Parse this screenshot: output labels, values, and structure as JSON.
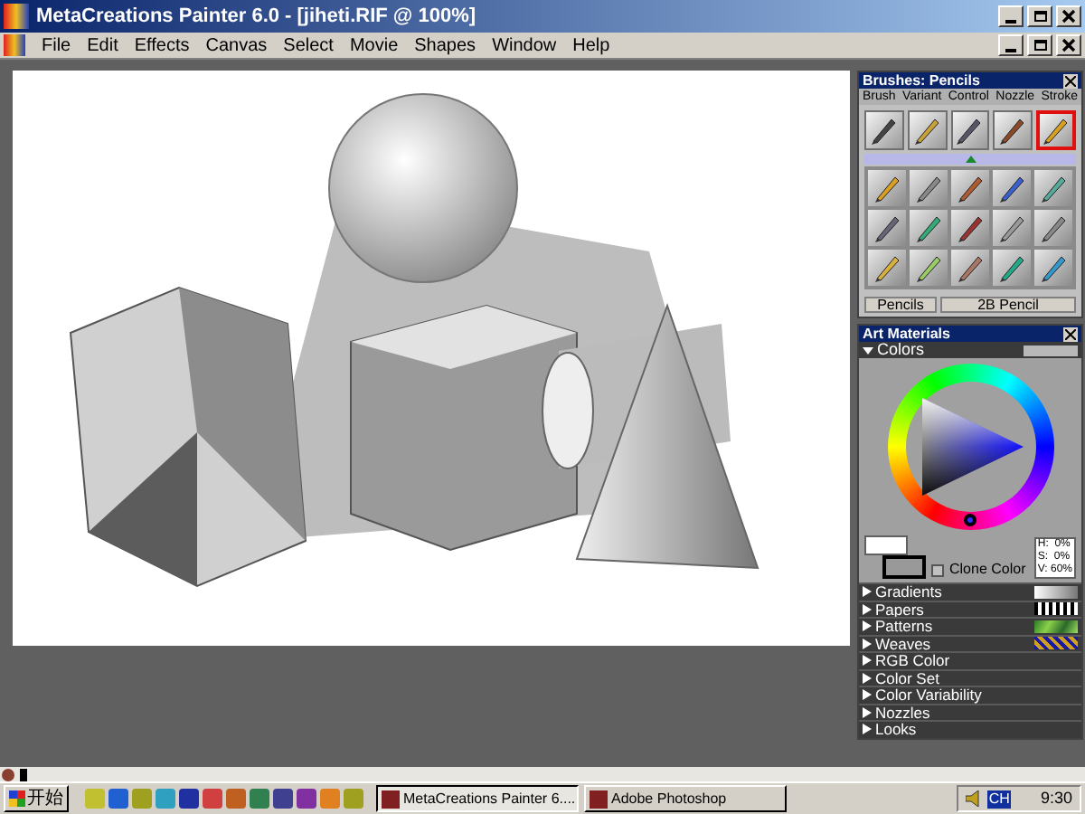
{
  "window": {
    "title": "MetaCreations Painter 6.0 - [jiheti.RIF @ 100%]"
  },
  "menu": [
    "File",
    "Edit",
    "Effects",
    "Canvas",
    "Select",
    "Movie",
    "Shapes",
    "Window",
    "Help"
  ],
  "brushes_palette": {
    "title": "Brushes: Pencils",
    "menu": [
      "Brush",
      "Variant",
      "Control",
      "Nozzle",
      "Stroke"
    ],
    "brushes": [
      {
        "selected": false
      },
      {
        "selected": false
      },
      {
        "selected": false
      },
      {
        "selected": false
      },
      {
        "selected": true
      }
    ],
    "category": "Pencils",
    "variant": "2B Pencil"
  },
  "art_materials": {
    "title": "Art Materials",
    "colors": {
      "label": "Colors",
      "expanded": true,
      "h": "H:  0%",
      "s": "S:  0%",
      "v": "V: 60%",
      "clone_color": {
        "label": "Clone Color",
        "checked": false
      }
    },
    "sections": [
      {
        "label": "Gradients",
        "kind": "gradient"
      },
      {
        "label": "Papers",
        "kind": "paper"
      },
      {
        "label": "Patterns",
        "kind": "pattern"
      },
      {
        "label": "Weaves",
        "kind": "weave"
      },
      {
        "label": "RGB Color"
      },
      {
        "label": "Color Set"
      },
      {
        "label": "Color Variability"
      },
      {
        "label": "Nozzles"
      },
      {
        "label": "Looks"
      }
    ]
  },
  "taskbar": {
    "start": "开始",
    "tasks": [
      {
        "label": "MetaCreations Painter 6....",
        "selected": true
      },
      {
        "label": "Adobe Photoshop",
        "selected": false
      }
    ],
    "language": "CH",
    "clock": "9:30"
  }
}
